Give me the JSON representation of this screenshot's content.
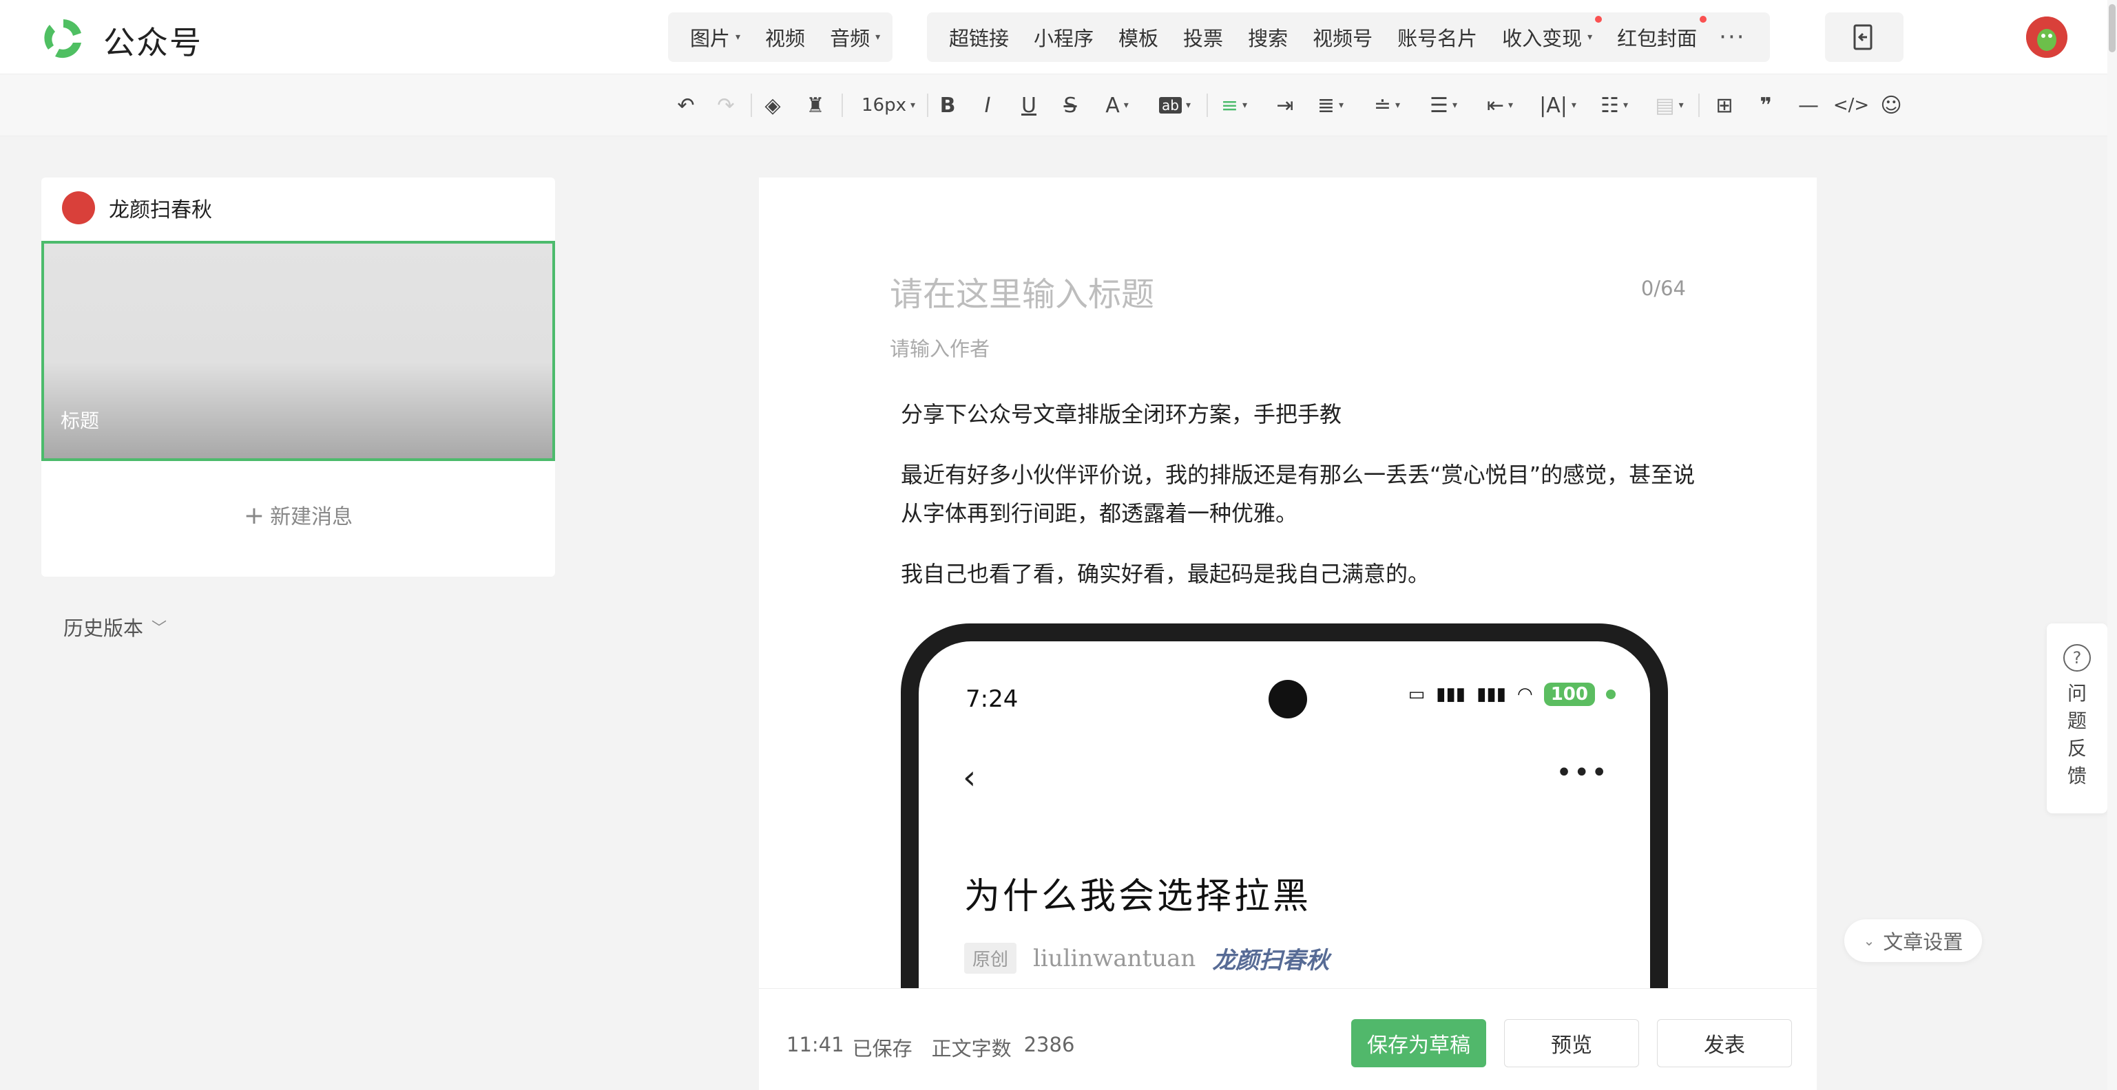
{
  "app": {
    "name": "公众号"
  },
  "insert_menu": [
    {
      "label": "图片",
      "dropdown": true
    },
    {
      "label": "视频",
      "dropdown": false
    },
    {
      "label": "音频",
      "dropdown": true
    }
  ],
  "insert_menu2": [
    {
      "label": "超链接"
    },
    {
      "label": "小程序"
    },
    {
      "label": "模板"
    },
    {
      "label": "投票"
    },
    {
      "label": "搜索"
    },
    {
      "label": "视频号"
    },
    {
      "label": "账号名片"
    },
    {
      "label": "收入变现",
      "dropdown": true,
      "new": true
    },
    {
      "label": "红包封面",
      "new": true
    }
  ],
  "toolbar": {
    "font_size": "16px",
    "more": "···"
  },
  "left_panel": {
    "account_name": "龙颜扫春秋",
    "cover_title": "标题",
    "new_message": "新建消息",
    "history": "历史版本"
  },
  "editor": {
    "title_placeholder": "请在这里输入标题",
    "title_counter": "0/64",
    "author_placeholder": "请输入作者",
    "paragraphs": [
      "分享下公众号文章排版全闭环方案，手把手教",
      "最近有好多小伙伴评价说，我的排版还是有那么一丢丢“赏心悦目”的感觉，甚至说从字体再到行间距，都透露着一种优雅。",
      "我自己也看了看，确实好看，最起码是我自己满意的。"
    ]
  },
  "phone_preview": {
    "time": "7:24",
    "battery": "100",
    "article_title": "为什么我会选择拉黑",
    "original_tag": "原创",
    "author_id": "liulinwantuan",
    "account": "龙颜扫春秋"
  },
  "bottom_bar": {
    "saved_time": "11:41",
    "saved_label": "已保存",
    "word_count_label": "正文字数",
    "word_count": "2386",
    "save_draft": "保存为草稿",
    "preview": "预览",
    "publish": "发表"
  },
  "side": {
    "feedback": "问题反馈",
    "article_settings": "文章设置"
  },
  "colors": {
    "brand_green": "#51b86b",
    "selection_border": "#4cbb6c",
    "red_dot": "#fa5151",
    "link_blue": "#576b95"
  }
}
